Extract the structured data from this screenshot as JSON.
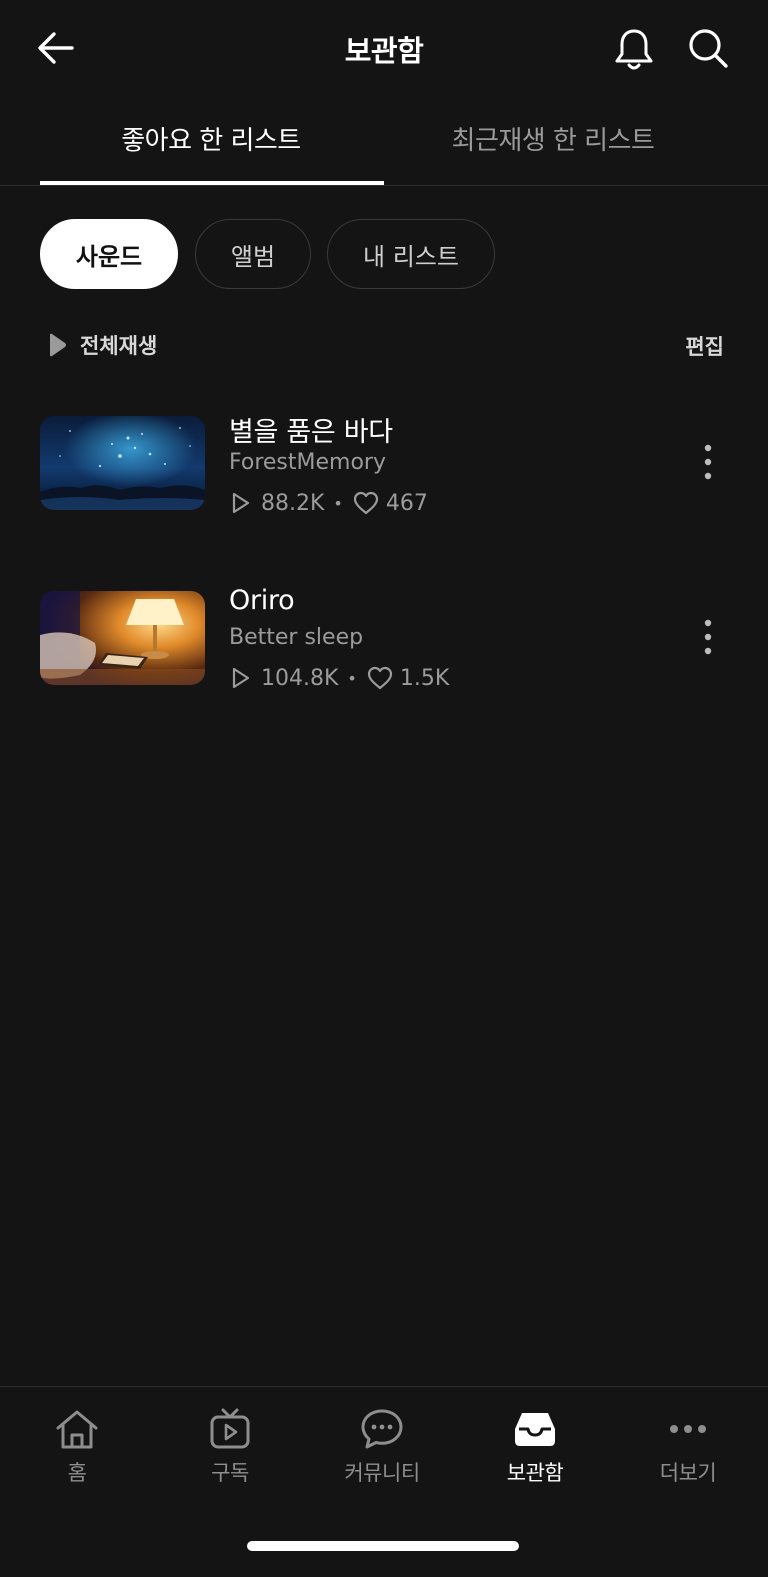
{
  "header": {
    "title": "보관함",
    "back_icon": "arrow-left-icon",
    "bell_icon": "bell-icon",
    "search_icon": "search-icon"
  },
  "tabs": [
    {
      "label": "좋아요 한 리스트",
      "active": true
    },
    {
      "label": "최근재생 한 리스트",
      "active": false
    }
  ],
  "chips": [
    {
      "label": "사운드",
      "selected": true
    },
    {
      "label": "앨범",
      "selected": false
    },
    {
      "label": "내 리스트",
      "selected": false
    }
  ],
  "list_controls": {
    "play_all_label": "전체재생",
    "edit_label": "편집"
  },
  "tracks": [
    {
      "title": "별을 품은 바다",
      "artist": "ForestMemory",
      "plays": "88.2K",
      "likes": "467"
    },
    {
      "title": "Oriro",
      "artist": "Better sleep",
      "plays": "104.8K",
      "likes": "1.5K"
    }
  ],
  "bottom_nav": [
    {
      "label": "홈",
      "icon": "home-icon",
      "active": false
    },
    {
      "label": "구독",
      "icon": "tv-play-icon",
      "active": false
    },
    {
      "label": "커뮤니티",
      "icon": "chat-bubble-icon",
      "active": false
    },
    {
      "label": "보관함",
      "icon": "inbox-tray-icon",
      "active": true
    },
    {
      "label": "더보기",
      "icon": "more-dots-icon",
      "active": false
    }
  ],
  "colors": {
    "background": "#141414",
    "text_primary": "#ffffff",
    "text_secondary": "#9b9b9b",
    "chip_selected_bg": "#ffffff"
  }
}
